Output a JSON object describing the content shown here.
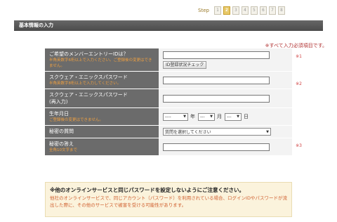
{
  "steps": {
    "label": "Step",
    "items": [
      "1",
      "2",
      "3",
      "4",
      "5",
      "6",
      "7",
      "8"
    ],
    "active_index": 1
  },
  "section": {
    "title": "基本情報の入力"
  },
  "required_note": "※すべて入力必須項目です。",
  "fields": [
    {
      "label": "ご希望のメンバーエントリーIDは？",
      "note": "半角英数字6桁以上で入力ください。ご登録後の変更はできません。",
      "check_button": "ID登録状況チェック",
      "required_marker": "※1"
    },
    {
      "label": "スクウェア・エニックスパスワード",
      "note": "半角英数字8桁以上で入力してください。",
      "required_marker": "※2"
    },
    {
      "label": "スクウェア・エニックスパスワード",
      "label_sub": "(再入力)",
      "note": ""
    },
    {
      "label": "生年月日",
      "note": "ご登録後の変更はできません。",
      "year_value": "----",
      "year_unit": "年",
      "month_value": "---",
      "month_unit": "月",
      "day_value": "---",
      "day_unit": "日"
    },
    {
      "label": "秘密の質問",
      "select_value": "質問を選択してください"
    },
    {
      "label": "秘密の答え",
      "note": "全角10文字まで",
      "required_marker": "※3"
    }
  ],
  "notice": {
    "title": "※他のオンラインサービスと同じパスワードを設定しないようにご注意ください。",
    "body": "他社のオンラインサービスで、同じアカウント（パスワード）を利用されている場合、ログインIDやパスワードが流出した際に、その他のサービスで被害を受ける可能性があります。"
  }
}
